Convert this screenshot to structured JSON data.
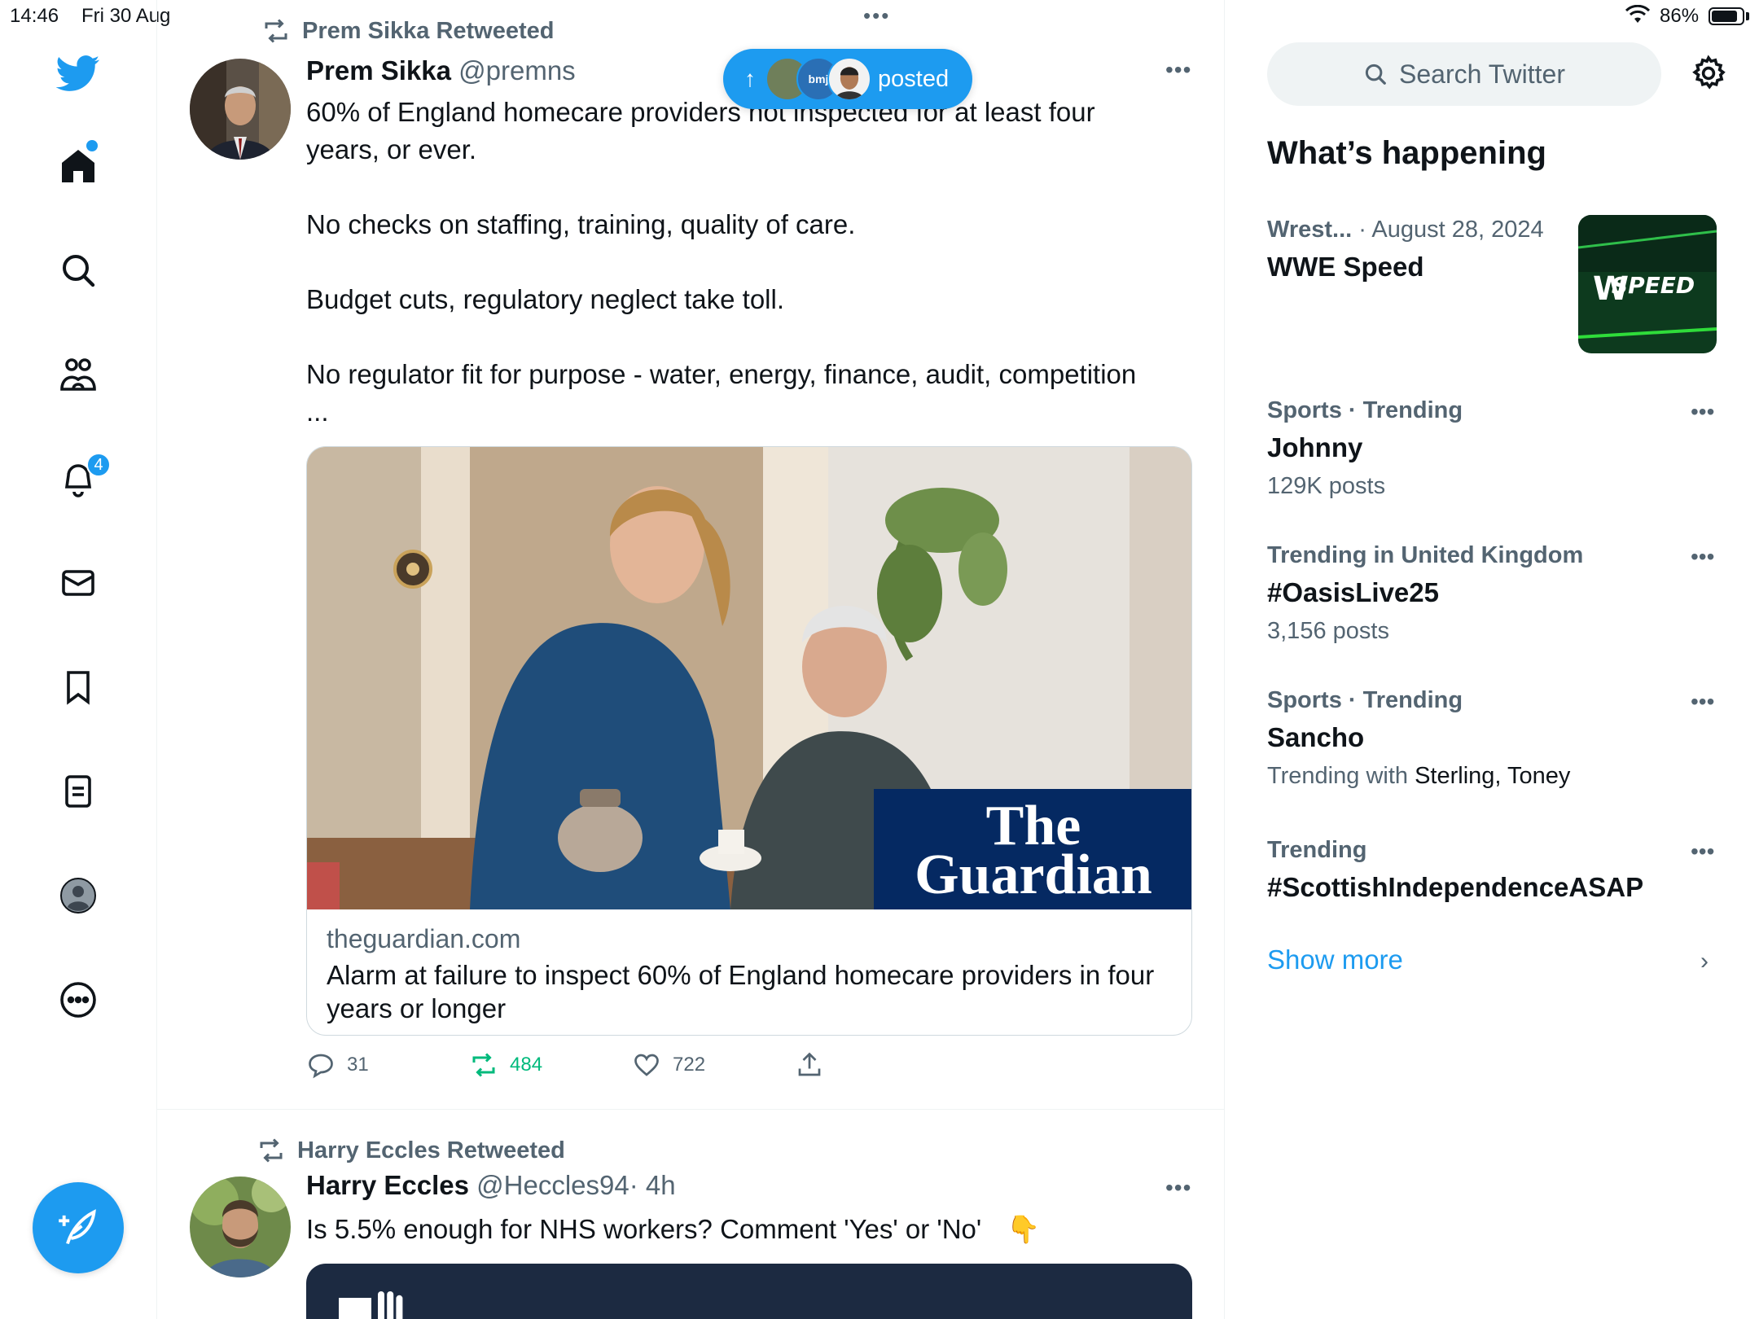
{
  "status_bar": {
    "time": "14:46",
    "date": "Fri 30 Aug",
    "battery_pct": "86%",
    "battery_level": 0.86
  },
  "nav": {
    "notifications_badge": "4",
    "items": [
      "twitter-logo",
      "home-icon",
      "search-icon",
      "communities-icon",
      "bell-icon",
      "mail-icon",
      "bookmark-icon",
      "lists-icon",
      "profile-icon",
      "more-icon"
    ]
  },
  "pill": {
    "label": "posted",
    "avatar_text": "bmj"
  },
  "tweets": [
    {
      "retweeted_by": "Prem Sikka Retweeted",
      "name": "Prem Sikka",
      "handle": "@premns",
      "body": [
        "60% of England homecare providers not inspected for at least four years, or ever.",
        "No checks on staffing, training, quality of care.",
        "Budget cuts, regulatory neglect take toll.",
        "No regulator fit for purpose - water, energy, finance, audit, competition ..."
      ],
      "card": {
        "logo_line1": "The",
        "logo_line2": "Guardian",
        "domain": "theguardian.com",
        "title": "Alarm at failure to inspect 60% of England homecare providers in four years or longer"
      },
      "replies": "31",
      "retweets": "484",
      "likes": "722"
    },
    {
      "retweeted_by": "Harry Eccles Retweeted",
      "name": "Harry Eccles",
      "handle": "@Heccles94",
      "time": "· 4h",
      "body": "Is 5.5% enough for NHS workers? Comment 'Yes' or 'No'",
      "emoji": "👇"
    }
  ],
  "right": {
    "search_placeholder": "Search Twitter",
    "section_title": "What’s happening",
    "trends": [
      {
        "meta_cat": "Wrest...",
        "meta_rest": " · August 28, 2024",
        "name": "WWE Speed",
        "thumb_text": "SPEED"
      },
      {
        "meta": "Sports · Trending",
        "name": "Johnny",
        "sub": "129K posts"
      },
      {
        "meta": "Trending in United Kingdom",
        "name": "#OasisLive25",
        "sub": "3,156 posts"
      },
      {
        "meta": "Sports · Trending",
        "name": "Sancho",
        "sub_prefix": "Trending with ",
        "sub_names": "Sterling, Toney"
      },
      {
        "meta": "Trending",
        "name": "#ScottishIndependenceASAP"
      }
    ],
    "show_more": "Show more"
  },
  "colors": {
    "accent": "#1d9bf0",
    "retweet_green": "#00ba7c",
    "text_primary": "#0f1419",
    "text_secondary": "#536471",
    "guardian_blue": "#052962"
  }
}
